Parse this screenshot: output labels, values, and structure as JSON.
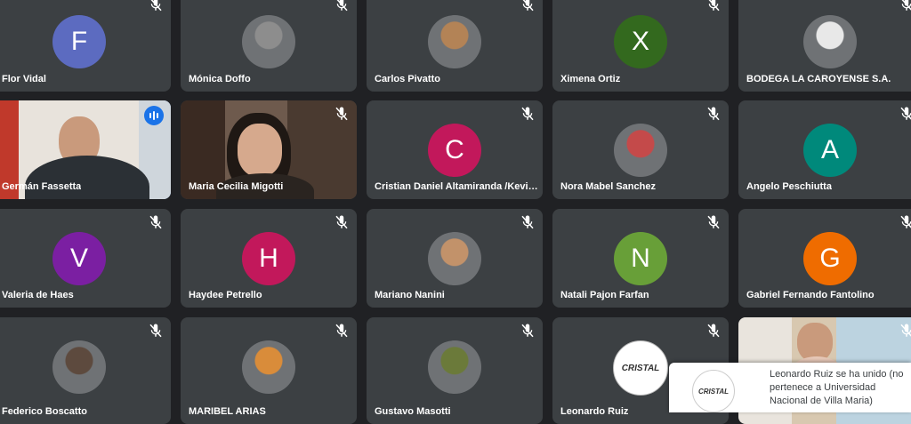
{
  "participants": [
    {
      "name": "Flor Vidal",
      "type": "letter",
      "initial": "F",
      "color": "#5c6bc0"
    },
    {
      "name": "Mónica Doffo",
      "type": "photo",
      "color": "#8d8d8d"
    },
    {
      "name": "Carlos Pivatto",
      "type": "photo",
      "color": "#b38356"
    },
    {
      "name": "Ximena Ortiz",
      "type": "letter",
      "initial": "X",
      "color": "#33691e"
    },
    {
      "name": "BODEGA LA CAROYENSE S.A.",
      "type": "photo",
      "color": "#e8e8e8"
    },
    {
      "name": "Germán Fassetta",
      "type": "video"
    },
    {
      "name": "Maria Cecilia Migotti",
      "type": "video"
    },
    {
      "name": "Cristian Daniel Altamiranda /Kevin Maximiliano",
      "type": "letter",
      "initial": "C",
      "color": "#c2185b"
    },
    {
      "name": "Nora Mabel Sanchez",
      "type": "photo",
      "color": "#c44a4a"
    },
    {
      "name": "Angelo Peschiutta",
      "type": "letter",
      "initial": "A",
      "color": "#00897b"
    },
    {
      "name": "Valeria de Haes",
      "type": "letter",
      "initial": "V",
      "color": "#7b1fa2"
    },
    {
      "name": "Haydee Petrello",
      "type": "letter",
      "initial": "H",
      "color": "#c2185b"
    },
    {
      "name": "Mariano Nanini",
      "type": "photo",
      "color": "#c2926a"
    },
    {
      "name": "Natali Pajon Farfan",
      "type": "letter",
      "initial": "N",
      "color": "#689f38"
    },
    {
      "name": "Gabriel Fernando Fantolino",
      "type": "letter",
      "initial": "G",
      "color": "#ef6c00"
    },
    {
      "name": "Federico Boscatto",
      "type": "photo",
      "color": "#5d4a3e"
    },
    {
      "name": "MARIBEL ARIAS",
      "type": "photo",
      "color": "#d98c3a"
    },
    {
      "name": "Gustavo Masotti",
      "type": "photo",
      "color": "#6b7a3a"
    },
    {
      "name": "Leonardo Ruiz",
      "type": "logo",
      "logo_text": "CRISTAL"
    },
    {
      "name": "",
      "type": "video"
    }
  ],
  "toast": {
    "logo_text": "CRISTAL",
    "message": "Leonardo Ruiz se ha unido (no pertenece a Universidad Nacional de Villa Maria)"
  }
}
